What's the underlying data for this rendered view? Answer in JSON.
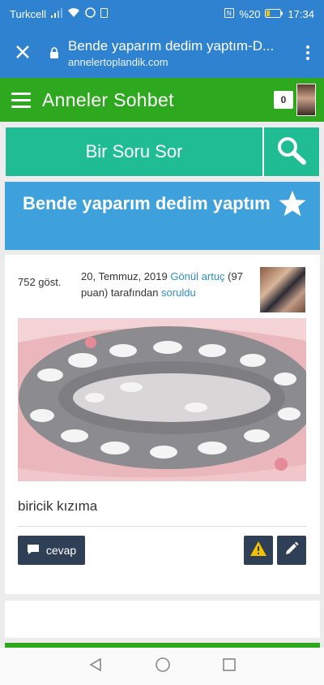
{
  "status_bar": {
    "carrier": "Turkcell",
    "battery": "%20",
    "time": "17:34",
    "icons": [
      "signal-icon",
      "wifi-icon",
      "whatsapp-icon",
      "sim-icon",
      "nfc-icon",
      "battery-icon"
    ]
  },
  "browser": {
    "page_title": "Bende yaparım dedim yaptım-D...",
    "domain": "annelertoplandik.com",
    "icons": [
      "close-icon",
      "lock-icon",
      "more-vert-icon"
    ]
  },
  "site_header": {
    "site_name": "Anneler Sohbet",
    "notification_count": "0",
    "icons": [
      "hamburger-icon",
      "avatar"
    ]
  },
  "search_row": {
    "ask_label": "Bir Soru Sor",
    "icons": [
      "search-icon"
    ]
  },
  "question": {
    "title": "Bende yaparım dedim yaptım",
    "views": "752 göst.",
    "date": "20, Temmuz, 2019",
    "author": "Gönül artuç",
    "points": "(97 puan)",
    "by_text": "tarafından",
    "asked_text": "soruldu",
    "body": "biricik kızıma",
    "icons": [
      "star-icon",
      "user-photo",
      "question-image"
    ]
  },
  "actions": {
    "answer_label": "cevap",
    "icons": [
      "comment-icon",
      "warning-icon",
      "pencil-icon"
    ]
  },
  "colors": {
    "browser_blue": "#2f82cf",
    "site_green": "#2ea81e",
    "ask_teal": "#20bd94",
    "title_blue": "#3fa1dc",
    "button_dark": "#2f3f55",
    "link_blue": "#2f8fc0",
    "warning_yellow": "#f2c200"
  },
  "nav_bar": {
    "icons": [
      "back-icon",
      "home-icon",
      "recents-icon"
    ]
  }
}
